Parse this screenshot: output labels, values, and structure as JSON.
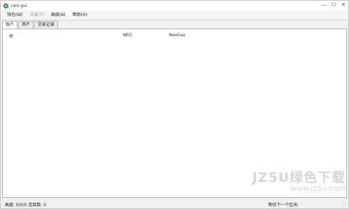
{
  "window": {
    "title": "neo-gui",
    "icon": "app-icon",
    "controls": {
      "minimize": "—",
      "maximize": "☐",
      "close": "✕"
    }
  },
  "menu": {
    "items": [
      {
        "label": "钱包(W)",
        "enabled": true
      },
      {
        "label": "交易(T)",
        "enabled": false
      },
      {
        "label": "高级(A)",
        "enabled": true
      },
      {
        "label": "帮助(H)",
        "enabled": true
      }
    ]
  },
  "tabs": [
    {
      "label": "账户",
      "active": true
    },
    {
      "label": "资产",
      "active": false
    },
    {
      "label": "交易记录",
      "active": false
    }
  ],
  "table": {
    "columns": [
      "地",
      "NEO",
      "NeoGas"
    ]
  },
  "status": {
    "left": "高度: 0/0/0 连接数: 0",
    "right": "等待下一个区块:"
  },
  "watermark": {
    "main": "JZ5U绿色下载",
    "sub": "www.jz5u.com"
  }
}
